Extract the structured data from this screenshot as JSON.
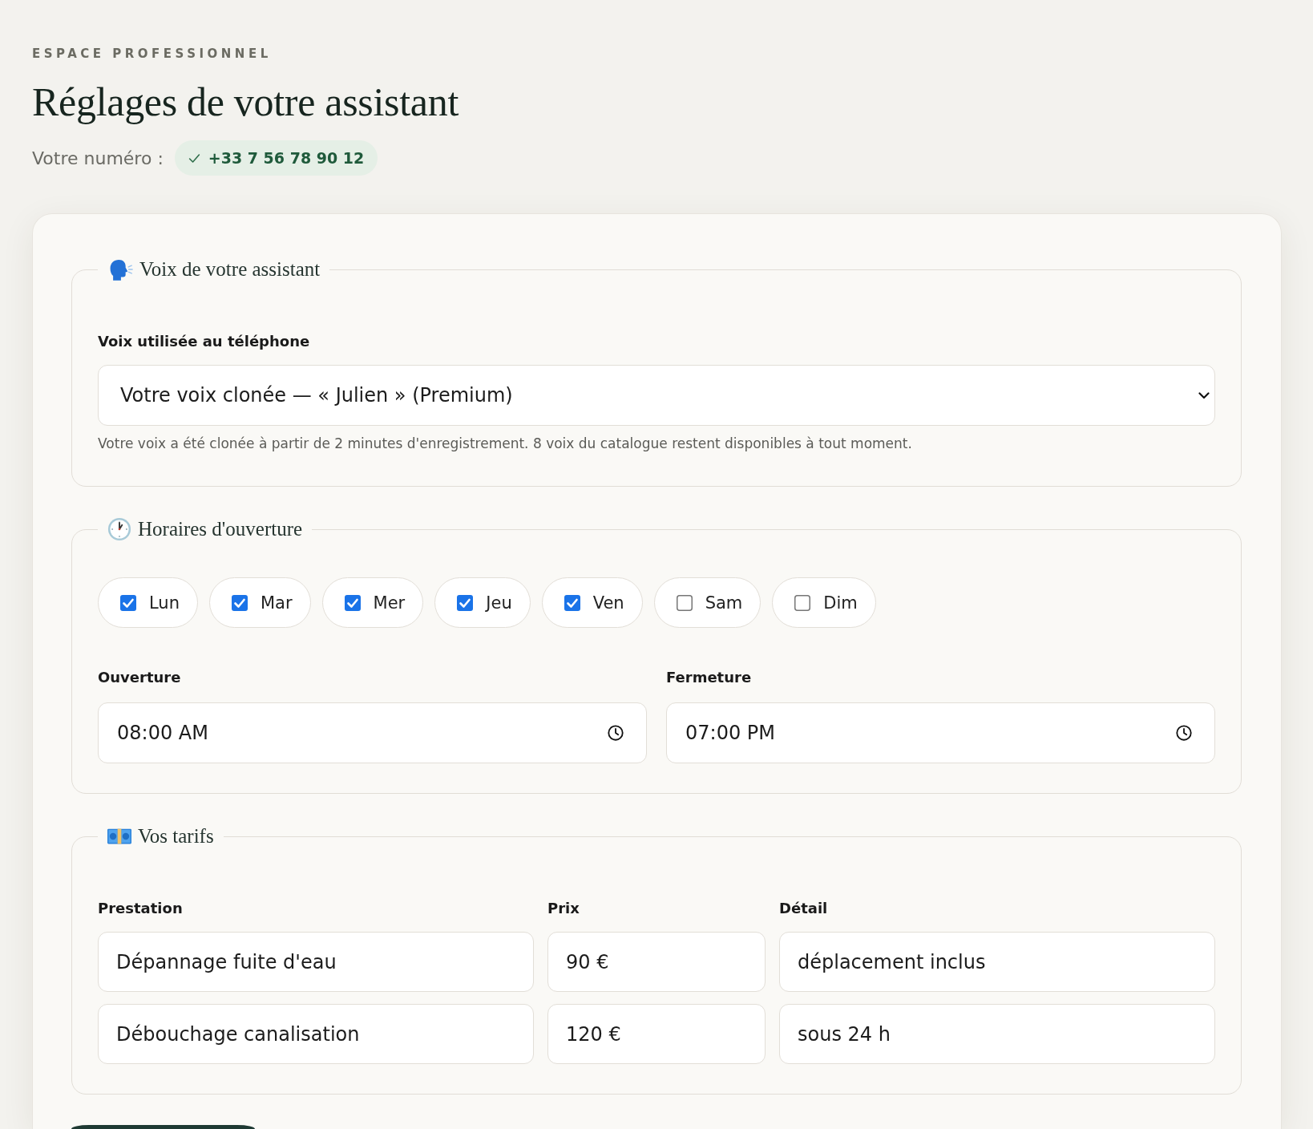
{
  "header": {
    "eyebrow": "ESPACE PROFESSIONNEL",
    "title": "Réglages de votre assistant",
    "number_label": "Votre numéro :",
    "number": {
      "verified": true,
      "value": "+33 7 56 78 90 12"
    }
  },
  "sections": [
    {
      "kind": "voice",
      "legend": "Voix de votre assistant",
      "field_label": "Voix utilisée au téléphone",
      "select": {
        "value": "Votre voix clonée — « Julien » (Premium)"
      },
      "help": "Votre voix a été clonée à partir de 2 minutes d'enregistrement. 8 voix du catalogue restent disponibles à tout moment."
    },
    {
      "kind": "hours",
      "legend": "Horaires d'ouverture",
      "days": [
        {
          "label": "Lun",
          "checked": true
        },
        {
          "label": "Mar",
          "checked": true
        },
        {
          "label": "Mer",
          "checked": true
        },
        {
          "label": "Jeu",
          "checked": true
        },
        {
          "label": "Ven",
          "checked": true
        },
        {
          "label": "Sam",
          "checked": false
        },
        {
          "label": "Dim",
          "checked": false
        }
      ],
      "times": [
        {
          "label": "Ouverture",
          "value": "08:00 AM"
        },
        {
          "label": "Fermeture",
          "value": "07:00 PM"
        }
      ]
    },
    {
      "kind": "rates",
      "legend": "Vos tarifs",
      "columns": [
        "Prestation",
        "Prix",
        "Détail"
      ],
      "rows": [
        {
          "cells": [
            "Dépannage fuite d'eau",
            "90 €",
            "déplacement inclus"
          ]
        },
        {
          "cells": [
            "Débouchage canalisation",
            "120 €",
            "sous 24 h"
          ]
        }
      ]
    }
  ],
  "actions": [
    {
      "kind": "primary"
    }
  ]
}
